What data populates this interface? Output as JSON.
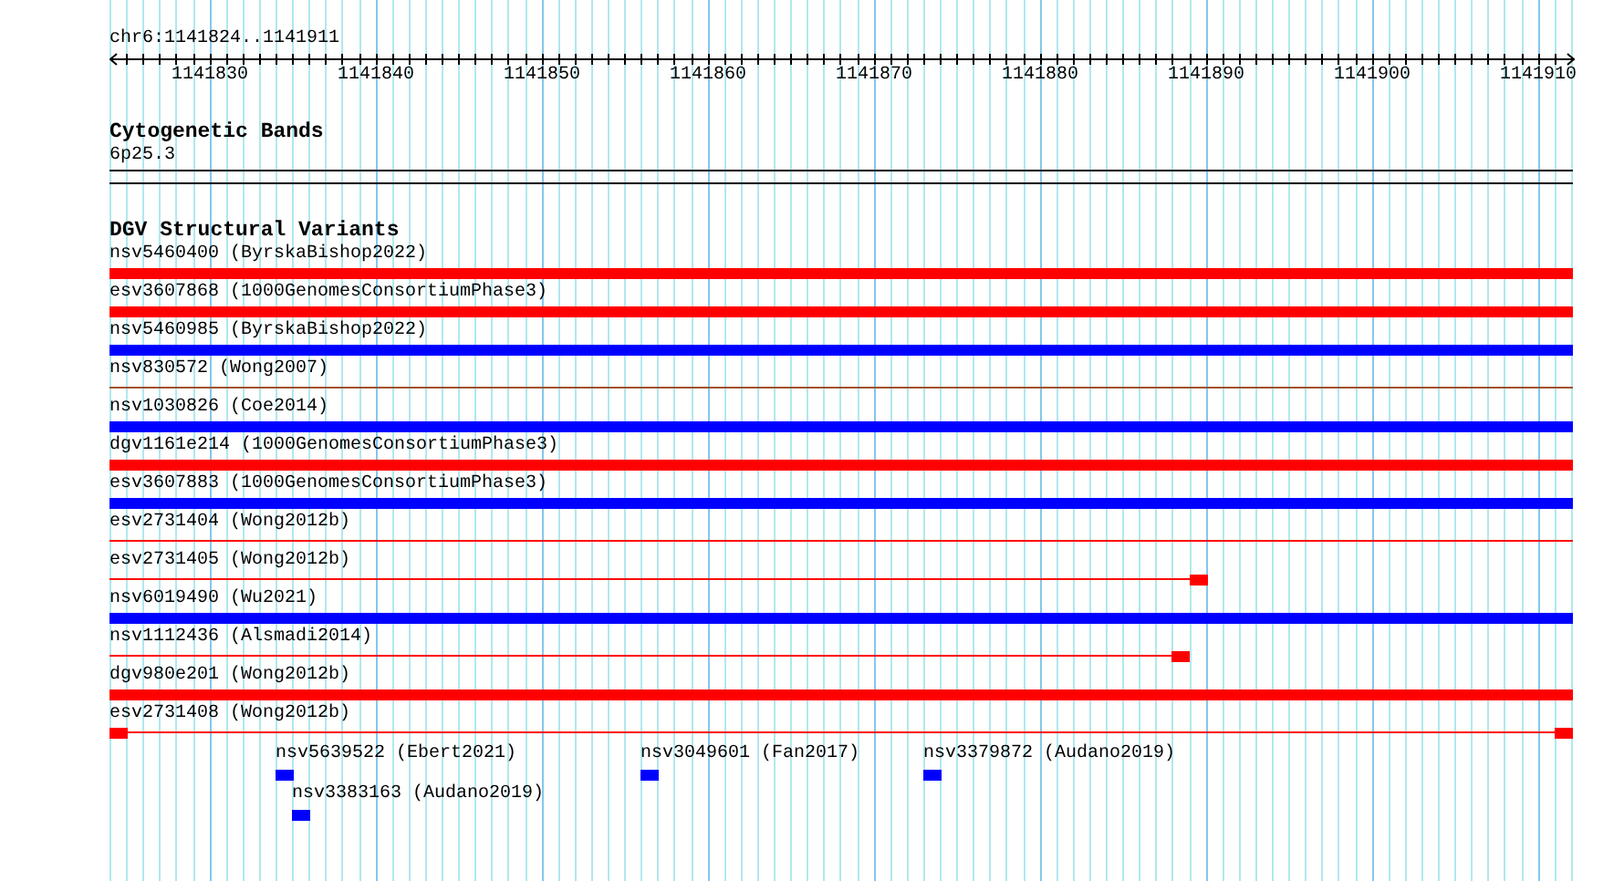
{
  "ruler": {
    "location": "chr6:1141824..1141911",
    "ticks": [
      "1141830",
      "1141840",
      "1141850",
      "1141860",
      "1141870",
      "1141880",
      "1141890",
      "1141900",
      "1141910"
    ]
  },
  "tracks": [
    {
      "title": "Cytogenetic Bands",
      "features": [
        {
          "label": "6p25.3",
          "kind": "band"
        }
      ]
    },
    {
      "title": "DGV Structural Variants",
      "features": [
        {
          "label": "nsv5460400 (ByrskaBishop2022)",
          "kind": "bar",
          "color": "#ff0000"
        },
        {
          "label": "esv3607868 (1000GenomesConsortiumPhase3)",
          "kind": "bar",
          "color": "#ff0000"
        },
        {
          "label": "nsv5460985 (ByrskaBishop2022)",
          "kind": "bar",
          "color": "#0000ff"
        },
        {
          "label": "nsv830572 (Wong2007)",
          "kind": "line",
          "color": "#a0522d"
        },
        {
          "label": "nsv1030826 (Coe2014)",
          "kind": "bar",
          "color": "#0000ff"
        },
        {
          "label": "dgv1161e214 (1000GenomesConsortiumPhase3)",
          "kind": "bar",
          "color": "#ff0000"
        },
        {
          "label": "esv3607883 (1000GenomesConsortiumPhase3)",
          "kind": "bar",
          "color": "#0000ff"
        },
        {
          "label": "esv2731404 (Wong2012b)",
          "kind": "line",
          "color": "#ff0000"
        },
        {
          "label": "esv2731405 (Wong2012b)",
          "kind": "line",
          "color": "#ff0000"
        },
        {
          "label": "nsv6019490 (Wu2021)",
          "kind": "bar",
          "color": "#0000ff"
        },
        {
          "label": "nsv1112436 (Alsmadi2014)",
          "kind": "line",
          "color": "#ff0000"
        },
        {
          "label": "dgv980e201 (Wong2012b)",
          "kind": "bar",
          "color": "#ff0000"
        },
        {
          "label": "esv2731408 (Wong2012b)",
          "kind": "line",
          "color": "#ff0000"
        },
        {
          "label": "nsv5639522 (Ebert2021)",
          "kind": "block",
          "color": "#0000ff"
        },
        {
          "label": "nsv3049601 (Fan2017)",
          "kind": "block",
          "color": "#0000ff"
        },
        {
          "label": "nsv3379872 (Audano2019)",
          "kind": "block",
          "color": "#0000ff"
        },
        {
          "label": "nsv3383163 (Audano2019)",
          "kind": "block",
          "color": "#0000ff"
        }
      ]
    }
  ]
}
